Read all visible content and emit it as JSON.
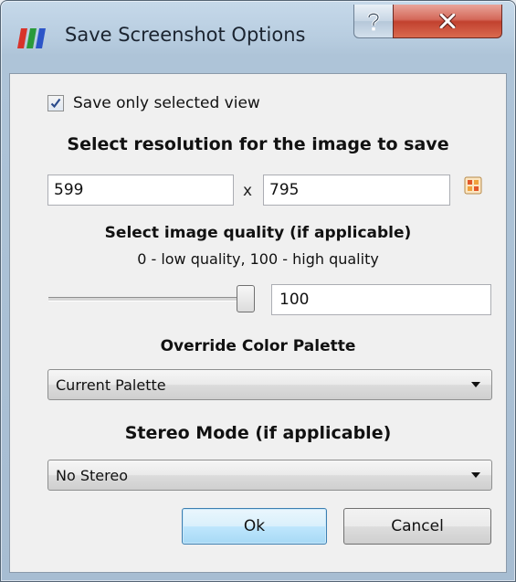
{
  "window": {
    "title": "Save Screenshot Options",
    "help_label": "?",
    "close_label": "X",
    "help_icon": "help-icon",
    "close_icon": "close-icon",
    "app_icon": "paraview-bars-icon"
  },
  "options": {
    "save_selected_label": "Save only selected view",
    "save_selected_checked": true
  },
  "resolution": {
    "heading": "Select resolution for the image to save",
    "width": "599",
    "separator": "x",
    "height": "795",
    "lock_icon": "aspect-lock-icon"
  },
  "quality": {
    "heading": "Select image quality (if applicable)",
    "subheading": "0 - low quality, 100 - high quality",
    "value": "100",
    "slider_min": 0,
    "slider_max": 100,
    "slider_value": 100
  },
  "palette": {
    "heading": "Override Color Palette",
    "selected": "Current Palette"
  },
  "stereo": {
    "heading": "Stereo Mode (if applicable)",
    "selected": "No Stereo"
  },
  "buttons": {
    "ok": "Ok",
    "cancel": "Cancel"
  },
  "colors": {
    "accent": "#3c7fb1",
    "close_red": "#c2412f",
    "icon_red": "#d8332a",
    "icon_green": "#2a9a3a",
    "icon_blue": "#2c55c8"
  }
}
